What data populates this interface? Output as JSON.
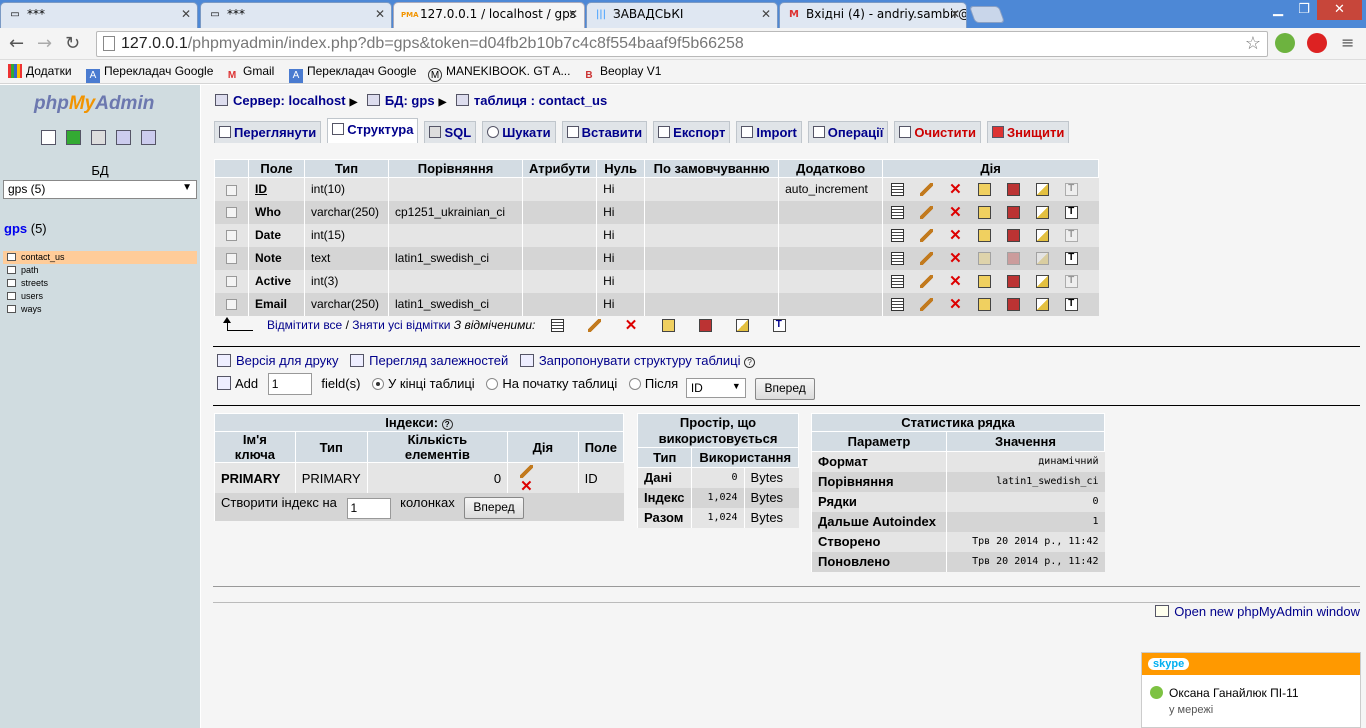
{
  "browser": {
    "tabs": [
      {
        "title": "***"
      },
      {
        "title": "***"
      },
      {
        "title": "127.0.0.1 / localhost / gps",
        "favicon": "PMA"
      },
      {
        "title": "ЗАВАДСЬКІ"
      },
      {
        "title": "Вхідні (4) - andriy.sambir@..."
      }
    ],
    "url_host": "127.0.0.1",
    "url_path": "/phpmyadmin/index.php?db=gps&token=d04fb2b10b7c4c8f554baaf9f5b66258",
    "bookmarks": [
      "Додатки",
      "Перекладач Google",
      "Gmail",
      "Перекладач Google",
      "MANEKIBOOK. GT A...",
      "Beoplay V1"
    ]
  },
  "sidebar": {
    "logo_php": "php",
    "logo_my": "My",
    "logo_admin": "Admin",
    "db_label": "БД",
    "db_select": "gps (5)",
    "db_name": "gps",
    "db_count": "(5)",
    "tables": [
      "contact_us",
      "path",
      "streets",
      "users",
      "ways"
    ]
  },
  "breadcrumb": {
    "server": "Сервер: localhost",
    "db": "БД: gps",
    "table": "таблиця : contact_us"
  },
  "tabs": [
    {
      "label": "Переглянути"
    },
    {
      "label": "Структура"
    },
    {
      "label": "SQL"
    },
    {
      "label": "Шукати"
    },
    {
      "label": "Вставити"
    },
    {
      "label": "Експорт"
    },
    {
      "label": "Import"
    },
    {
      "label": "Операції"
    },
    {
      "label": "Очистити"
    },
    {
      "label": "Знищити"
    }
  ],
  "structure": {
    "headers": [
      "Поле",
      "Тип",
      "Порівняння",
      "Атрибути",
      "Нуль",
      "По замовчуванню",
      "Додатково",
      "Дія"
    ],
    "rows": [
      {
        "name": "ID",
        "type": "int(10)",
        "collation": "",
        "attributes": "",
        "null": "Ні",
        "default": "",
        "extra": "auto_increment"
      },
      {
        "name": "Who",
        "type": "varchar(250)",
        "collation": "cp1251_ukrainian_ci",
        "attributes": "",
        "null": "Ні",
        "default": "",
        "extra": ""
      },
      {
        "name": "Date",
        "type": "int(15)",
        "collation": "",
        "attributes": "",
        "null": "Ні",
        "default": "",
        "extra": ""
      },
      {
        "name": "Note",
        "type": "text",
        "collation": "latin1_swedish_ci",
        "attributes": "",
        "null": "Ні",
        "default": "",
        "extra": ""
      },
      {
        "name": "Active",
        "type": "int(3)",
        "collation": "",
        "attributes": "",
        "null": "Ні",
        "default": "",
        "extra": ""
      },
      {
        "name": "Email",
        "type": "varchar(250)",
        "collation": "latin1_swedish_ci",
        "attributes": "",
        "null": "Ні",
        "default": "",
        "extra": ""
      }
    ],
    "check_all": "Відмітити все",
    "uncheck_all": "Зняти усі відмітки",
    "with_selected": "З відміченими:"
  },
  "links": {
    "print": "Версія для друку",
    "relations": "Перегляд залежностей",
    "propose": "Запропонувати структуру таблиці"
  },
  "add_fields": {
    "add": "Add",
    "count": "1",
    "fields": "field(s)",
    "at_end": "У кінці таблиці",
    "at_begin": "На початку таблиці",
    "after": "Після",
    "after_value": "ID",
    "go": "Вперед"
  },
  "indexes": {
    "title": "Індекси:",
    "headers": [
      "Ім'я ключа",
      "Тип",
      "Кількість елементів",
      "Дія",
      "Поле"
    ],
    "row": {
      "key": "PRIMARY",
      "type": "PRIMARY",
      "cardinality": "0",
      "field": "ID"
    },
    "create_label": "Створити індекс на",
    "create_count": "1",
    "columns_label": "колонках",
    "go": "Вперед"
  },
  "space": {
    "title": "Простір, що використовується",
    "headers": [
      "Тип",
      "Використання"
    ],
    "rows": [
      {
        "type": "Дані",
        "value": "0",
        "unit": "Bytes"
      },
      {
        "type": "Індекс",
        "value": "1,024",
        "unit": "Bytes"
      },
      {
        "type": "Разом",
        "value": "1,024",
        "unit": "Bytes"
      }
    ]
  },
  "stats": {
    "title": "Статистика рядка",
    "headers": [
      "Параметр",
      "Значення"
    ],
    "rows": [
      {
        "param": "Формат",
        "value": "динамічний"
      },
      {
        "param": "Порівняння",
        "value": "latin1_swedish_ci"
      },
      {
        "param": "Рядки",
        "value": "0"
      },
      {
        "param": "Дальше Autoindex",
        "value": "1"
      },
      {
        "param": "Створено",
        "value": "Трв 20 2014 р., 11:42"
      },
      {
        "param": "Поновлено",
        "value": "Трв 20 2014 р., 11:42"
      }
    ]
  },
  "open_new": "Open new phpMyAdmin window",
  "skype": {
    "brand": "skype",
    "contact": "Оксана Ганайлюк ПІ-11",
    "status": "у мережі"
  }
}
